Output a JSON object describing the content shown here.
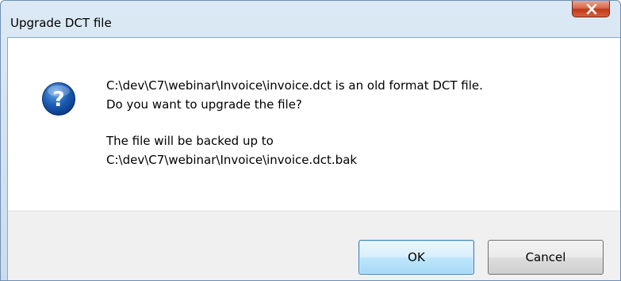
{
  "window": {
    "title": "Upgrade DCT file",
    "close_icon": "close-icon"
  },
  "message": {
    "icon": "question-icon",
    "line1": "C:\\dev\\C7\\webinar\\Invoice\\invoice.dct is an old format DCT file.",
    "line2": "Do you want to upgrade the file?",
    "line3": "The file will be backed up to",
    "line4": "C:\\dev\\C7\\webinar\\Invoice\\invoice.dct.bak"
  },
  "buttons": {
    "ok_label": "OK",
    "cancel_label": "Cancel"
  },
  "colors": {
    "title_bar": "#c9dcee",
    "close_button": "#c0391c",
    "question_icon": "#1d5fb6",
    "button_bar": "#f0f0f0"
  }
}
